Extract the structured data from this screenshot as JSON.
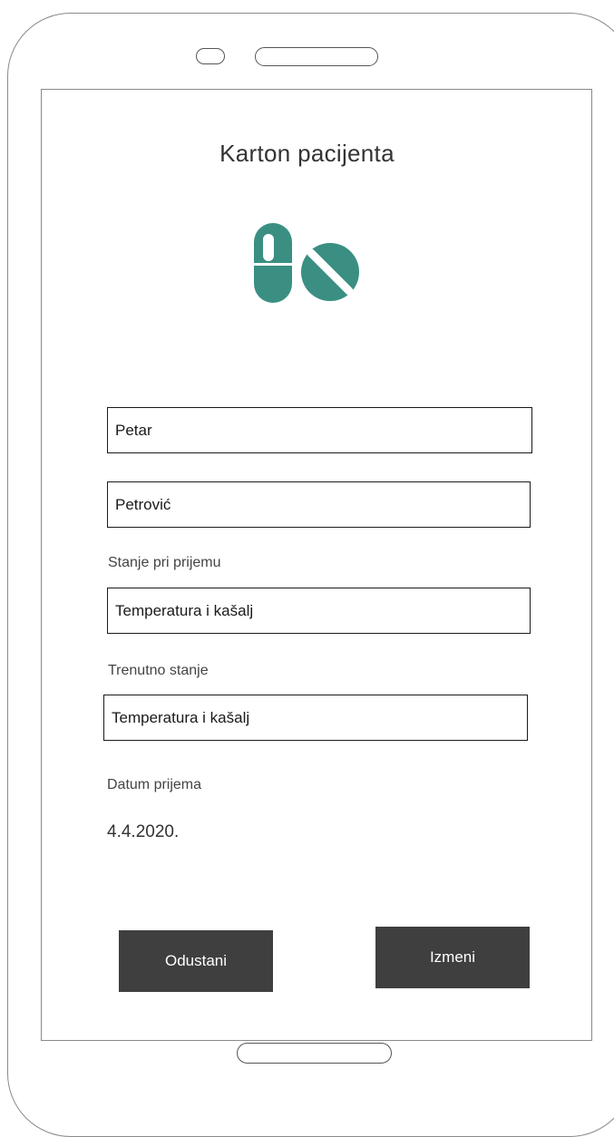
{
  "form": {
    "title": "Karton pacijenta",
    "icon": "pills-icon",
    "accent_color": "#3a8f82",
    "first_name_value": "Petar",
    "last_name_value": "Petrović",
    "admission_condition_label": "Stanje pri prijemu",
    "admission_condition_value": "Temperatura i kašalj",
    "current_condition_label": "Trenutno stanje",
    "current_condition_value": "Temperatura i kašalj",
    "admission_date_label": "Datum prijema",
    "admission_date_value": "4.4.2020."
  },
  "actions": {
    "cancel_label": "Odustani",
    "edit_label": "Izmeni"
  }
}
